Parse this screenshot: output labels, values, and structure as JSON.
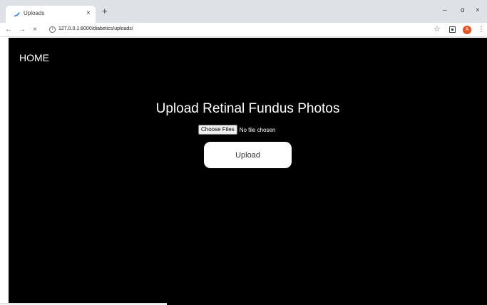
{
  "browser": {
    "tab_title": "Uploads",
    "tab_close": "×",
    "new_tab": "+",
    "window_controls": {
      "minimize": "–",
      "restore": "ɑ",
      "close": "×"
    },
    "nav": {
      "back": "←",
      "forward": "→",
      "reload": "×"
    },
    "url": "127.0.0.1:8000/diabetics/uploads/",
    "info_icon": "i",
    "star": "☆",
    "avatar_letter": "A",
    "menu": "⋮"
  },
  "page": {
    "home_link": "HOME",
    "title": "Upload Retinal Fundus Photos",
    "file_input": {
      "button_label": "Choose Files",
      "status": "No file chosen"
    },
    "upload_button": "Upload"
  },
  "colors": {
    "page_background": "#000000",
    "avatar": "#e8501f",
    "tab_strip": "#dee1e6"
  },
  "icons": [
    "uploads-favicon-icon",
    "close-icon",
    "plus-icon",
    "minimize-icon",
    "restore-icon",
    "back-arrow-icon",
    "forward-arrow-icon",
    "reload-icon",
    "info-icon",
    "star-icon",
    "extension-icon",
    "kebab-menu-icon"
  ]
}
